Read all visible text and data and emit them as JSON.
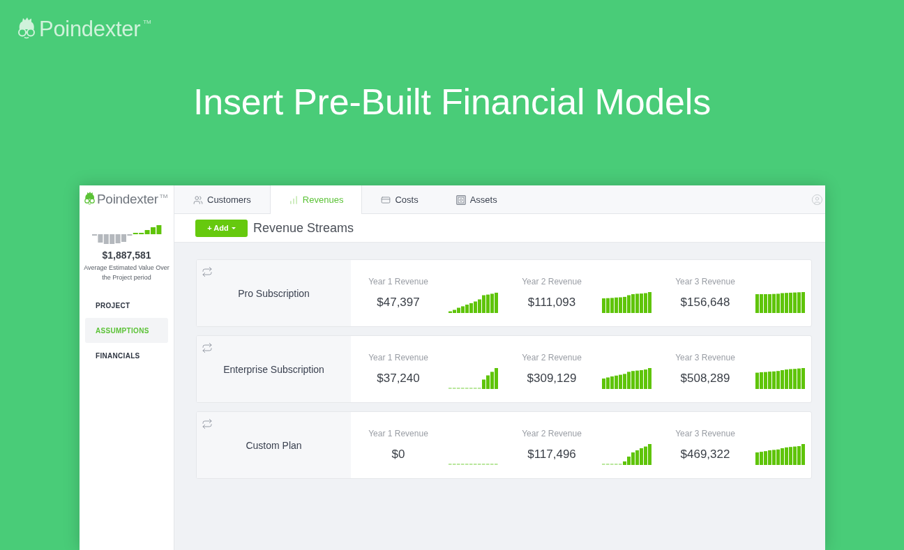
{
  "brand": {
    "name": "Poindexter",
    "trademark": "TM"
  },
  "headline": "Insert Pre-Built Financial Models",
  "app": {
    "sidebar": {
      "brand": {
        "name": "Poindexter",
        "trademark": "TM"
      },
      "summary": {
        "value": "$1,887,581",
        "caption": "Average Estimated Value Over the Project period"
      },
      "nav": [
        {
          "label": "PROJECT",
          "selected": false
        },
        {
          "label": "ASSUMPTIONS",
          "selected": true
        },
        {
          "label": "FINANCIALS",
          "selected": false
        }
      ]
    },
    "tabs": [
      {
        "label": "Customers",
        "selected": false
      },
      {
        "label": "Revenues",
        "selected": true
      },
      {
        "label": "Costs",
        "selected": false
      },
      {
        "label": "Assets",
        "selected": false
      }
    ],
    "toolbar": {
      "add_button": "+ Add",
      "title": "Revenue Streams"
    },
    "streams": [
      {
        "name": "Pro Subscription",
        "years": [
          {
            "label": "Year 1 Revenue",
            "value": "$47,397"
          },
          {
            "label": "Year 2 Revenue",
            "value": "$111,093"
          },
          {
            "label": "Year 3 Revenue",
            "value": "$156,648"
          }
        ]
      },
      {
        "name": "Enterprise Subscription",
        "years": [
          {
            "label": "Year 1 Revenue",
            "value": "$37,240"
          },
          {
            "label": "Year 2 Revenue",
            "value": "$309,129"
          },
          {
            "label": "Year 3 Revenue",
            "value": "$508,289"
          }
        ]
      },
      {
        "name": "Custom Plan",
        "years": [
          {
            "label": "Year 1 Revenue",
            "value": "$0"
          },
          {
            "label": "Year 2 Revenue",
            "value": "$117,496"
          },
          {
            "label": "Year 3 Revenue",
            "value": "$469,322"
          }
        ]
      }
    ]
  }
}
